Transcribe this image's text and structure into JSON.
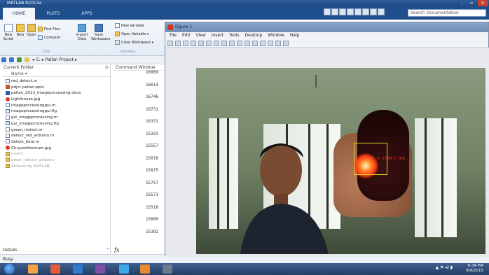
{
  "window": {
    "title": "MATLAB R2013a",
    "controls": {
      "minimize": "–",
      "maximize": "▫",
      "close": "✕"
    }
  },
  "ribbon": {
    "tabs": [
      "HOME",
      "PLOTS",
      "APPS"
    ],
    "active_tab": "HOME",
    "search_placeholder": "Search Documentation",
    "buttons": {
      "new_script": "New\nScript",
      "new": "New",
      "open": "Open",
      "find_files": "Find Files",
      "compare": "Compare",
      "import_data": "Import\nData",
      "save_workspace": "Save\nWorkspace",
      "new_variable": "New Variable",
      "open_variable": "Open Variable ▾",
      "clear_workspace": "Clear Workspace ▾"
    },
    "groups": {
      "file": "FILE",
      "variable": "VARIABLE"
    }
  },
  "address": {
    "path": "▸ C: ▸ Pallan Project ▸"
  },
  "current_folder": {
    "title": "Current Folder",
    "column_name": "Name ▾",
    "files": [
      {
        "name": "red_detect.m",
        "icon": "m-file-icon",
        "dim": false
      },
      {
        "name": "pdjct pallan.pptx",
        "icon": "powerpoint-file-icon",
        "dim": false
      },
      {
        "name": "pallan_2013_imageprocessing.docx",
        "icon": "word-file-icon",
        "dim": false
      },
      {
        "name": "Lighthouse.jpg",
        "icon": "image-file-icon",
        "dim": false
      },
      {
        "name": "imageprocessinggui.m",
        "icon": "m-file-icon",
        "dim": false
      },
      {
        "name": "imageprocessinggui.fig",
        "icon": "fig-file-icon",
        "dim": false
      },
      {
        "name": "gui_imageprocessing.m",
        "icon": "m-file-icon",
        "dim": false
      },
      {
        "name": "gui_imageprocessing.fig",
        "icon": "fig-file-icon",
        "dim": false
      },
      {
        "name": "green_instsct.m",
        "icon": "m-file-icon",
        "dim": false
      },
      {
        "name": "detect_red_arduino.m",
        "icon": "m-file-icon",
        "dim": false
      },
      {
        "name": "detect_blue.m",
        "icon": "m-file-icon",
        "dim": false
      },
      {
        "name": "Chrysanthemum.jpg",
        "icon": "image-file-icon",
        "dim": false
      },
      {
        "name": "insect",
        "icon": "folder-icon",
        "dim": true
      },
      {
        "name": "green_detect_arduino",
        "icon": "folder-icon",
        "dim": true
      },
      {
        "name": "Arduino by MATLAB",
        "icon": "folder-icon",
        "dim": true
      }
    ],
    "details_label": "Details"
  },
  "command_window": {
    "title": "Command Window",
    "values": [
      "16069",
      "16614",
      "16746",
      "16731",
      "16331",
      "15333",
      "15557",
      "15076",
      "15875",
      "15757",
      "15571",
      "15518",
      "15600",
      "15392"
    ],
    "prompt_symbol": "fx"
  },
  "status_bar": {
    "text": "Busy"
  },
  "figure": {
    "title": "Figure 1",
    "menu": [
      "File",
      "Edit",
      "View",
      "Insert",
      "Tools",
      "Desktop",
      "Window",
      "Help"
    ],
    "detection_label": "X: 1734  Y: 168",
    "bbox_color": "#e6cf2e",
    "label_color": "#ff2a20"
  },
  "taskbar": {
    "time": "6:34 PM",
    "date": "8/9/2015"
  },
  "colors": {
    "titlebar": "#1f4b87",
    "ribbon_tab_bar": "#1f4e8c",
    "taskbar": "#2b4670"
  }
}
